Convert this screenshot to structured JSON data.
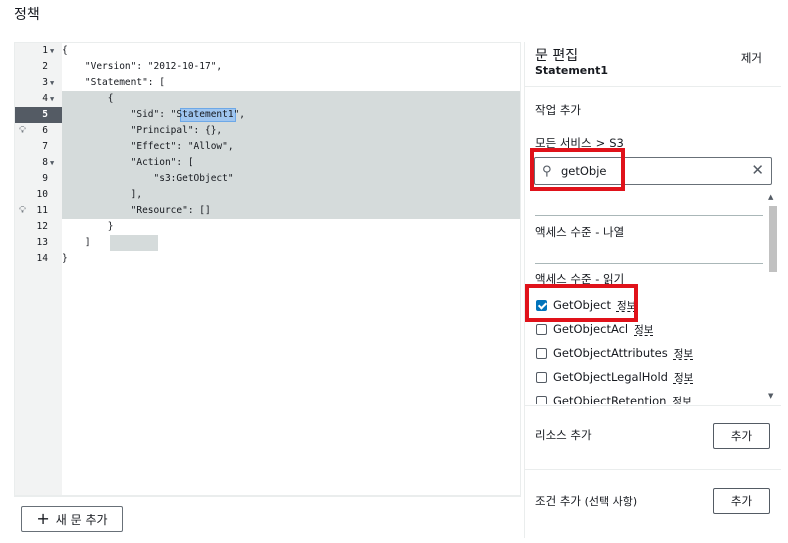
{
  "page": {
    "title": "정책"
  },
  "editor": {
    "line_numbers": [
      "1",
      "2",
      "3",
      "4",
      "5",
      "6",
      "7",
      "8",
      "9",
      "10",
      "11",
      "12",
      "13",
      "14"
    ],
    "lines": [
      "{",
      "    \"Version\": \"2012-10-17\",",
      "    \"Statement\": [",
      "        {",
      "            \"Sid\": \"Statement1\",",
      "            \"Principal\": {},",
      "            \"Effect\": \"Allow\",",
      "            \"Action\": [",
      "                \"s3:GetObject\"",
      "            ],",
      "            \"Resource\": []",
      "        }",
      "    ]",
      "}"
    ],
    "new_statement_button": "새 문 추가"
  },
  "panel": {
    "title": "문 편집",
    "statement_name": "Statement1",
    "remove_label": "제거",
    "add_action_label": "작업 추가",
    "breadcrumb": {
      "all_services": "모든 서비스",
      "separator": ">",
      "service": "S3"
    },
    "search": {
      "value": "getObje"
    },
    "access_list_label": "액세스 수준 - 나열",
    "access_read_label": "액세스 수준 - 읽기",
    "info_label": "정보",
    "actions": [
      {
        "name": "GetObject",
        "checked": true
      },
      {
        "name": "GetObjectAcl",
        "checked": false
      },
      {
        "name": "GetObjectAttributes",
        "checked": false
      },
      {
        "name": "GetObjectLegalHold",
        "checked": false
      },
      {
        "name": "GetObjectRetention",
        "checked": false
      }
    ],
    "add_resource_label": "리소스 추가",
    "add_condition_label": "조건 추가",
    "add_condition_optional": "(선택 사항)",
    "add_button": "추가"
  }
}
